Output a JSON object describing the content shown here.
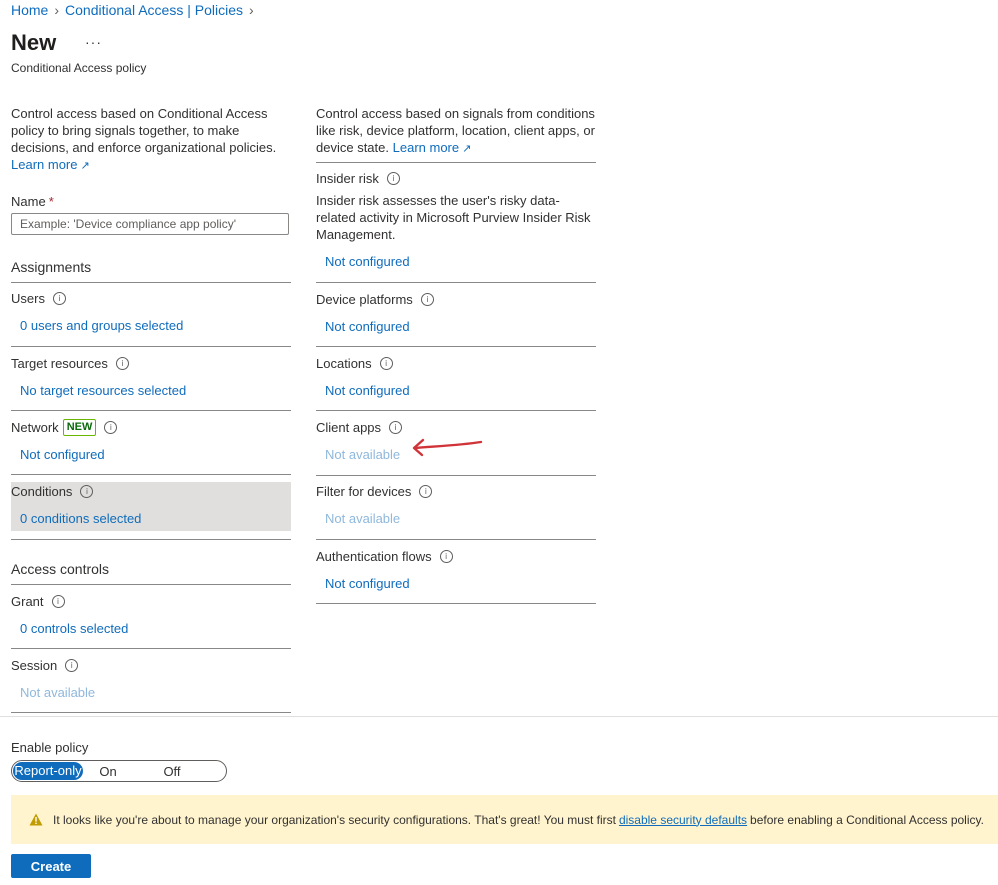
{
  "breadcrumb": {
    "home": "Home",
    "policies": "Conditional Access | Policies"
  },
  "page": {
    "title": "New",
    "more": "···",
    "subtitle": "Conditional Access policy"
  },
  "left": {
    "intro": "Control access based on Conditional Access policy to bring signals together, to make decisions, and enforce organizational policies.",
    "learn_more": "Learn more",
    "name_label": "Name",
    "name_required": "*",
    "name_placeholder": "Example: 'Device compliance app policy'",
    "assignments": "Assignments",
    "users_label": "Users",
    "users_value": "0 users and groups selected",
    "target_label": "Target resources",
    "target_value": "No target resources selected",
    "network_label": "Network",
    "network_badge": "NEW",
    "network_value": "Not configured",
    "conditions_label": "Conditions",
    "conditions_value": "0 conditions selected",
    "access_controls": "Access controls",
    "grant_label": "Grant",
    "grant_value": "0 controls selected",
    "session_label": "Session",
    "session_value": "Not available"
  },
  "right": {
    "intro": "Control access based on signals from conditions like risk, device platform, location, client apps, or device state.",
    "learn_more": "Learn more",
    "insider_label": "Insider risk",
    "insider_desc": "Insider risk assesses the user's risky data-related activity in Microsoft Purview Insider Risk Management.",
    "insider_value": "Not configured",
    "platforms_label": "Device platforms",
    "platforms_value": "Not configured",
    "locations_label": "Locations",
    "locations_value": "Not configured",
    "clientapps_label": "Client apps",
    "clientapps_value": "Not available",
    "filter_label": "Filter for devices",
    "filter_value": "Not available",
    "authflows_label": "Authentication flows",
    "authflows_value": "Not configured"
  },
  "enable": {
    "label": "Enable policy",
    "options": [
      "Report-only",
      "On",
      "Off"
    ],
    "selected": "Report-only"
  },
  "banner": {
    "text_before": "It looks like you're about to manage your organization's security configurations. That's great! You must first",
    "link": "disable security defaults",
    "text_after": "before enabling a Conditional Access policy."
  },
  "create_label": "Create",
  "colors": {
    "accent": "#0f6cbd",
    "warning_bg": "#fff4ce",
    "annotation": "#d13438"
  }
}
